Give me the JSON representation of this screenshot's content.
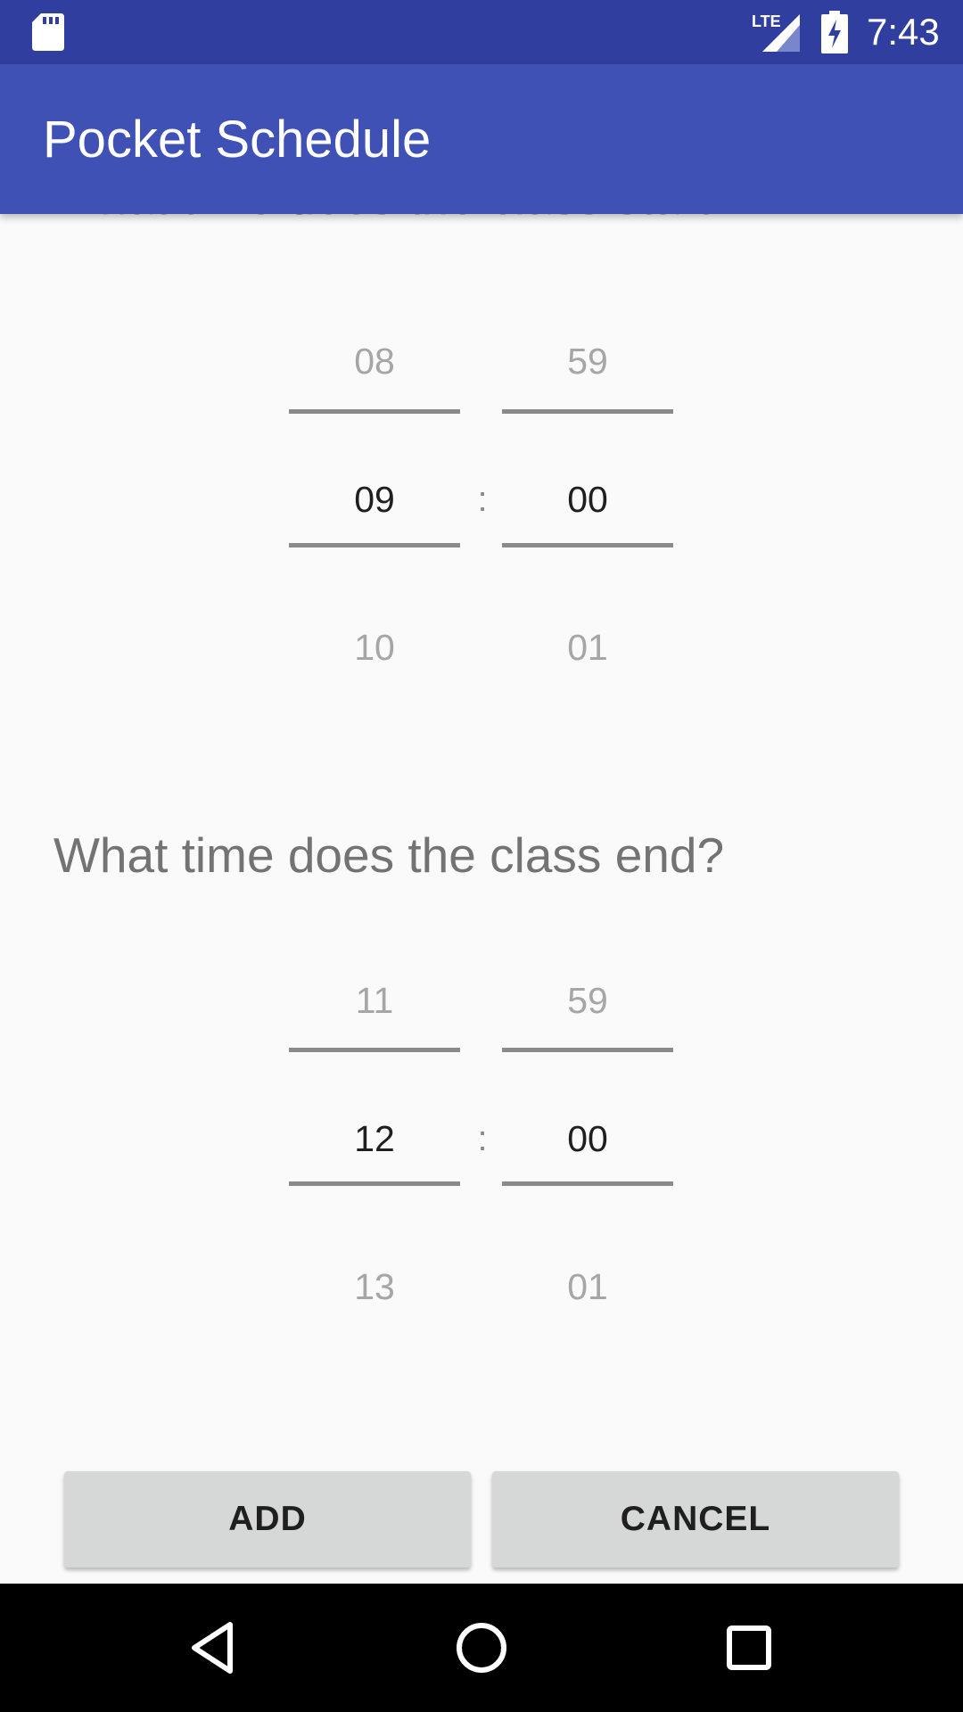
{
  "status_bar": {
    "time": "7:43",
    "network_label": "LTE",
    "icons": [
      "sd-card-icon",
      "lte-signal-icon",
      "battery-charging-icon"
    ]
  },
  "app_bar": {
    "title": "Pocket Schedule"
  },
  "start_section": {
    "question": "What time does the class start?",
    "hour": {
      "prev": "08",
      "current": "09",
      "next": "10"
    },
    "separator": ":",
    "minute": {
      "prev": "59",
      "current": "00",
      "next": "01"
    }
  },
  "end_section": {
    "question": "What time does the class end?",
    "hour": {
      "prev": "11",
      "current": "12",
      "next": "13"
    },
    "separator": ":",
    "minute": {
      "prev": "59",
      "current": "00",
      "next": "01"
    }
  },
  "buttons": {
    "add": "ADD",
    "cancel": "CANCEL"
  },
  "nav_bar": {
    "icons": [
      "back-icon",
      "home-icon",
      "recents-icon"
    ]
  },
  "colors": {
    "status_bar": "#303f9f",
    "app_bar": "#3f51b5",
    "background": "#fafafa",
    "button": "#d6d7d7"
  }
}
